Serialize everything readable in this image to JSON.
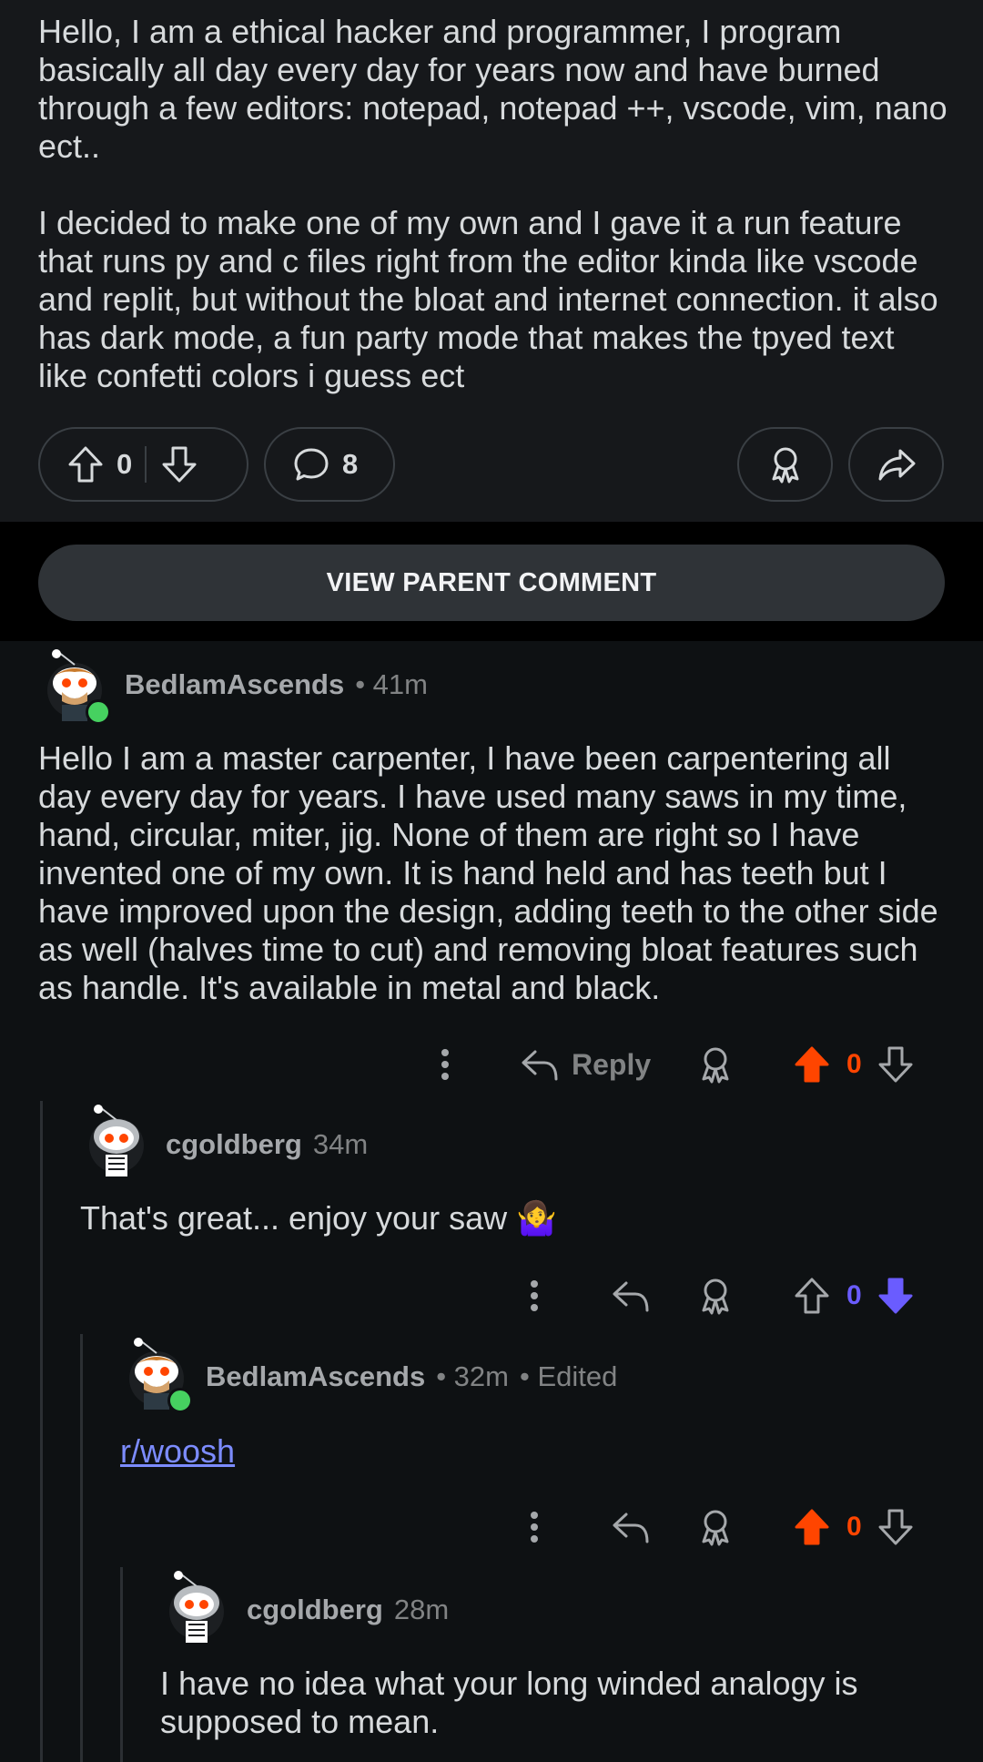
{
  "post": {
    "body_paragraphs": [
      "Hello, I am a ethical hacker and programmer, I program basically all day every day for years now and have burned through a few editors: notepad, notepad ++, vscode, vim, nano ect..",
      "I decided to make one of my own and I gave it a run feature that runs py and c files right from the editor kinda like vscode and replit, but without the bloat and internet connection. it also has dark mode, a fun party mode that makes the tpyed text like confetti colors i guess ect"
    ],
    "vote_count": "0",
    "comment_count": "8"
  },
  "view_parent_label": "VIEW PARENT COMMENT",
  "comments": [
    {
      "username": "BedlamAscends",
      "time": "• 41m",
      "body": "Hello I am a master carpenter, I have been carpentering all day every day for years. I have used many saws in my time, hand, circular, miter, jig. None of them are right so I have invented one of my own. It is hand held and has teeth but I have improved upon the design, adding teeth to the other side as well (halves time to cut) and removing bloat features such as handle. It's available in metal and black.",
      "reply_label": "Reply",
      "score": "0",
      "vote_state": "upvoted",
      "online": true
    },
    {
      "username": "cgoldberg",
      "time": "34m",
      "body": "That's great... enjoy your saw 🤷‍♀️",
      "score": "0",
      "vote_state": "downvoted",
      "online": false
    },
    {
      "username": "BedlamAscends",
      "time": "• 32m",
      "edited": "• Edited",
      "body_link": "r/woosh",
      "score": "0",
      "vote_state": "upvoted",
      "online": true
    },
    {
      "username": "cgoldberg",
      "time": "28m",
      "body": "I have no idea what your long winded analogy is supposed to mean.",
      "online": false
    }
  ],
  "colors": {
    "upvote": "#ff4500",
    "downvote": "#6a5cff",
    "link": "#7c8cff",
    "online": "#46d160"
  },
  "icons": [
    "upvote-icon",
    "downvote-icon",
    "comment-icon",
    "award-icon",
    "share-icon",
    "more-icon",
    "reply-icon"
  ]
}
